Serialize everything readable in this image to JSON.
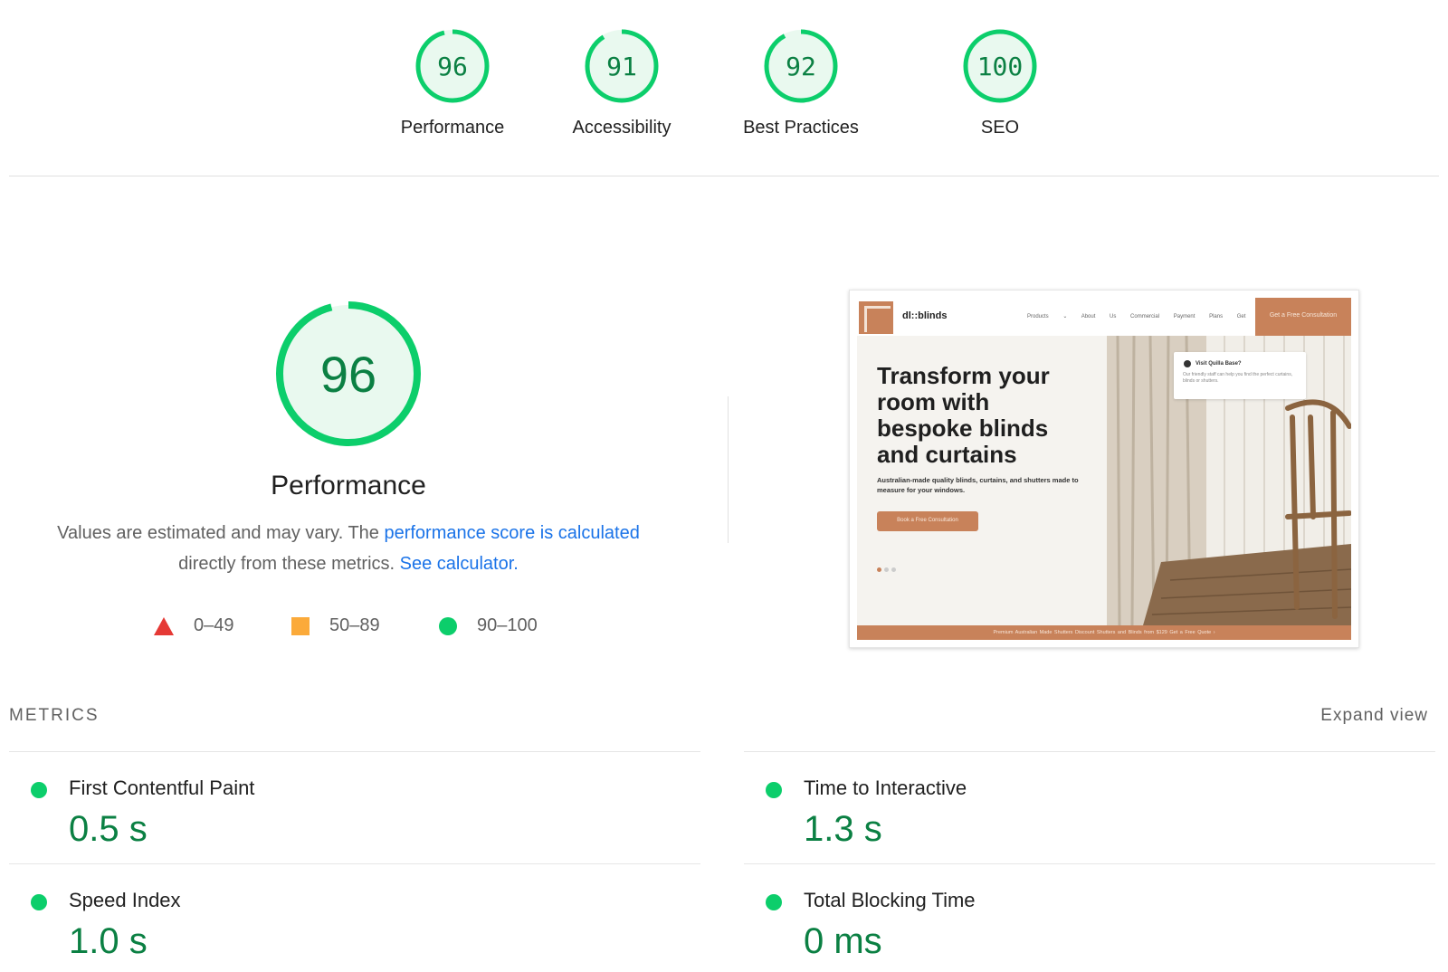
{
  "gauges": [
    {
      "score": "96",
      "label": "Performance",
      "value": 96
    },
    {
      "score": "91",
      "label": "Accessibility",
      "value": 91
    },
    {
      "score": "92",
      "label": "Best Practices",
      "value": 92
    },
    {
      "score": "100",
      "label": "SEO",
      "value": 100
    }
  ],
  "performance": {
    "score": "96",
    "value": 96,
    "title": "Performance",
    "desc_prefix": "Values are estimated and may vary. The ",
    "desc_link1": "performance score is calculated",
    "desc_middle": "directly from these metrics. ",
    "desc_link2": "See calculator.",
    "legend": [
      {
        "range": "0–49",
        "shape": "triangle-icon",
        "color": "#e53935"
      },
      {
        "range": "50–89",
        "shape": "square-icon",
        "color": "#fbaa3a"
      },
      {
        "range": "90–100",
        "shape": "circle-icon",
        "color": "#0cce6b"
      }
    ]
  },
  "screenshot": {
    "brand": "dl::blinds",
    "nav_links": "Products ⌄ About Us Commercial Payment Plans Get a Quote",
    "cta": "Get a Free Consultation",
    "headline": "Transform your room with bespoke blinds and curtains",
    "subtext": "Australian-made quality blinds, curtains, and shutters made to measure for your windows.",
    "button": "Book a Free Consultation",
    "popup_title": "Visit Quilla Base?",
    "popup_text": "Our friendly staff can help you find the perfect curtains, blinds or shutters.",
    "bottom_bar": "Premium Australian Made Shutters    Discount Shutters and Blinds from $129    Get a Free Quote ›"
  },
  "metrics": {
    "title": "METRICS",
    "expand": "Expand view",
    "items": [
      {
        "name": "First Contentful Paint",
        "value": "0.5 s"
      },
      {
        "name": "Time to Interactive",
        "value": "1.3 s"
      },
      {
        "name": "Speed Index",
        "value": "1.0 s"
      },
      {
        "name": "Total Blocking Time",
        "value": "0 ms"
      }
    ]
  },
  "colors": {
    "pass": "#0cce6b",
    "pass_text": "#0b8043",
    "pass_fill": "#e9f9ef",
    "fail": "#e53935",
    "average": "#fbaa3a",
    "link": "#1a73e8",
    "brand": "#c8825a"
  }
}
